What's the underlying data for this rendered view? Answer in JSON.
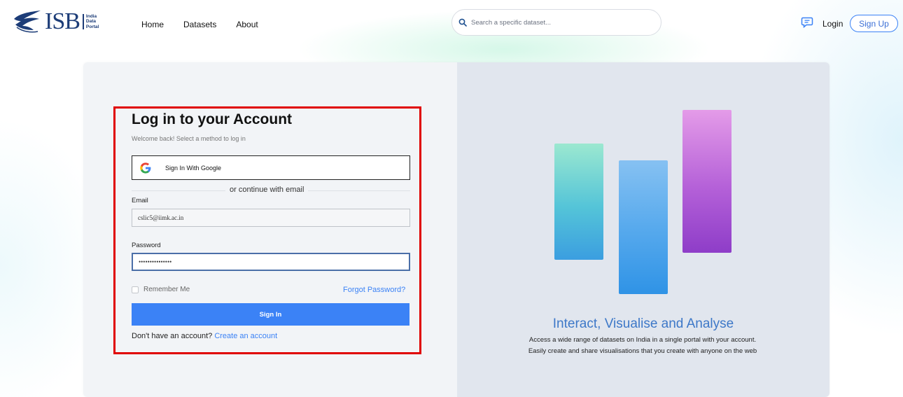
{
  "header": {
    "logo_text": "ISB",
    "logo_sub": [
      "India",
      "Data",
      "Portal"
    ],
    "nav": [
      "Home",
      "Datasets",
      "About"
    ],
    "search_placeholder": "Search a specific dataset...",
    "login_label": "Login",
    "signup_label": "Sign Up"
  },
  "form": {
    "title": "Log in to your Account",
    "subtitle": "Welcome back! Select a method to log in",
    "google_label": "Sign In With Google",
    "divider_text": "or continue with email",
    "email_label": "Email",
    "email_value": "cslic5@iimk.ac.in",
    "password_label": "Password",
    "password_value": "•••••••••••••••",
    "remember_label": "Remember Me",
    "forgot_label": "Forgot Password?",
    "signin_label": "Sign In",
    "no_account_text": "Don't have an account?",
    "create_account_label": "Create an account"
  },
  "promo": {
    "tagline": "Interact, Visualise and Analyse",
    "description": "Access a wide range of datasets on India in a single portal with your account. Easily create and share visualisations that you create with anyone on the web"
  },
  "colors": {
    "accent": "#3b82f6",
    "brand": "#1d3d78",
    "highlight": "#e00000"
  }
}
